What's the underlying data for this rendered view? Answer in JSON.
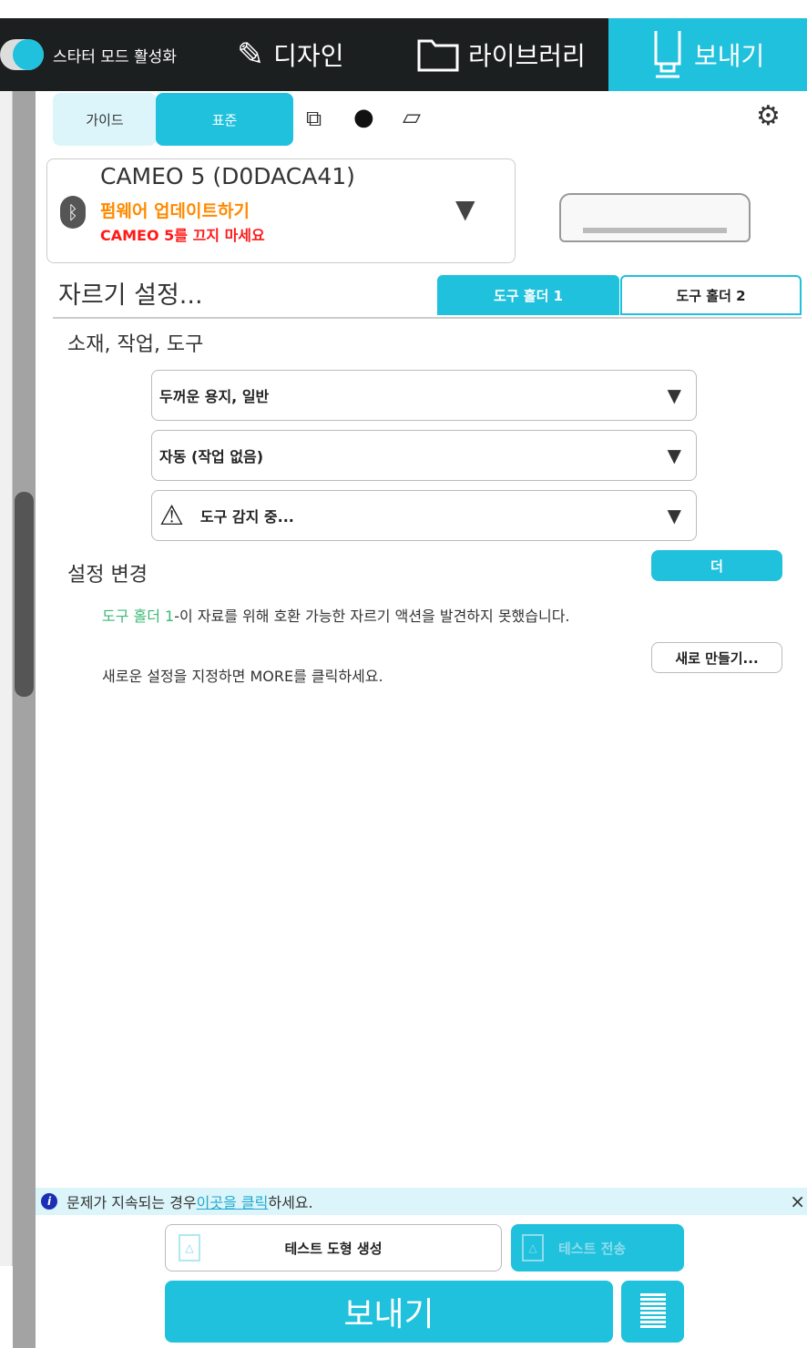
{
  "header": {
    "starter_mode_label": "스타터 모드 활성화",
    "tabs": [
      {
        "label": "디자인"
      },
      {
        "label": "라이브러리"
      },
      {
        "label": "보내기"
      }
    ]
  },
  "mode_tabs": {
    "guide": "가이드",
    "standard": "표준"
  },
  "device": {
    "name": "CAMEO 5 (D0DACA41)",
    "firmware": "펌웨어 업데이트하기",
    "warning": "CAMEO 5를 끄지 마세요"
  },
  "cut_settings": {
    "title": "자르기 설정...",
    "tool_holder_1": "도구 홀더 1",
    "tool_holder_2": "도구 홀더 2"
  },
  "material": {
    "heading": "소재, 작업, 도구",
    "material_value": "두꺼운 용지, 일반",
    "action_value": "자동 (작업 없음)",
    "tool_value": "도구 감지 중..."
  },
  "change": {
    "heading": "설정 변경",
    "more_label": "더",
    "msg_highlight": "도구 홀더 1",
    "msg_rest": "-이 자료를 위해 호환 가능한 자르기 액션을 발견하지 못했습니다.",
    "msg2": "새로운 설정을 지정하면 MORE를 클릭하세요.",
    "new_label": "새로 만들기..."
  },
  "info": {
    "prefix": "문제가 지속되는 경우 ",
    "link": "이곳을 클릭",
    "suffix": "하세요.",
    "close": "×"
  },
  "footer": {
    "test_shape": "테스트 도형 생성",
    "test_send": "테스트 전송",
    "send": "보내기"
  },
  "colors": {
    "accent": "#1fc1dc",
    "header": "#1c1f20",
    "firmware": "#ff8a00",
    "warning": "#ff1a1a",
    "highlight": "#3cb878"
  }
}
